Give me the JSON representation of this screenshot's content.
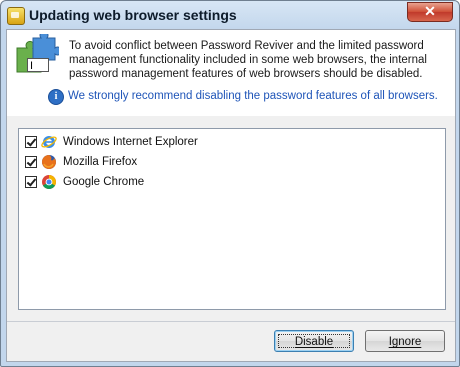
{
  "window": {
    "title": "Updating web browser settings",
    "close_label": "✕"
  },
  "header": {
    "intro": "To avoid conflict between Password Reviver and the limited password management functionality included in some web browsers, the internal password management features of web browsers should be disabled.",
    "recommendation": "We strongly recommend disabling the password features of all browsers.",
    "info_glyph": "i",
    "cursor_glyph": "I"
  },
  "browsers": [
    {
      "label": "Windows Internet Explorer",
      "checked": true,
      "icon": "internet-explorer-icon"
    },
    {
      "label": "Mozilla Firefox",
      "checked": true,
      "icon": "firefox-icon"
    },
    {
      "label": "Google Chrome",
      "checked": true,
      "icon": "chrome-icon"
    }
  ],
  "buttons": {
    "disable": "Disable",
    "ignore": "Ignore"
  },
  "colors": {
    "accent_text": "#1f55b8",
    "titlebar": "#c2d6ec",
    "close": "#c0392b"
  }
}
